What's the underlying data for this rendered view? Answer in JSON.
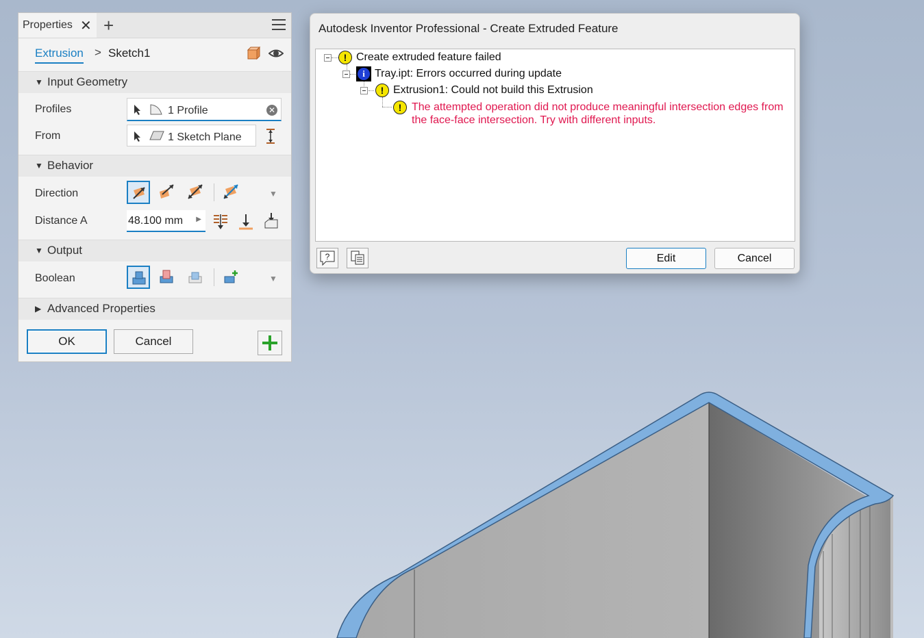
{
  "panel": {
    "tab_label": "Properties",
    "breadcrumb": {
      "feature": "Extrusion",
      "separator": ">",
      "sketch": "Sketch1"
    },
    "sections": {
      "input_geometry": "Input Geometry",
      "behavior": "Behavior",
      "output": "Output",
      "advanced": "Advanced Properties"
    },
    "fields": {
      "profiles_label": "Profiles",
      "profiles_value": "1 Profile",
      "from_label": "From",
      "from_value": "1 Sketch Plane",
      "direction_label": "Direction",
      "distance_label": "Distance A",
      "distance_value": "48.100 mm",
      "boolean_label": "Boolean"
    },
    "buttons": {
      "ok": "OK",
      "cancel": "Cancel"
    },
    "colors": {
      "accent": "#1a7fc3",
      "orange": "#f0a060",
      "apply_plus": "#2aa22a"
    }
  },
  "dialog": {
    "title": "Autodesk Inventor Professional - Create Extruded Feature",
    "tree": {
      "root": "Create extruded feature failed",
      "file": "Tray.ipt: Errors occurred during update",
      "feature": "Extrusion1: Could not build this Extrusion",
      "message": "The attempted operation did not produce meaningful intersection edges from the face-face intersection. Try with different inputs."
    },
    "buttons": {
      "edit": "Edit",
      "cancel": "Cancel"
    },
    "colors": {
      "error_text": "#e0174f",
      "warning_fill": "#f5e600",
      "info_fill": "#1f3fd6"
    }
  },
  "viewport": {
    "colors": {
      "part_face": "#9c9c9c",
      "part_edge": "#7fb0df"
    }
  }
}
